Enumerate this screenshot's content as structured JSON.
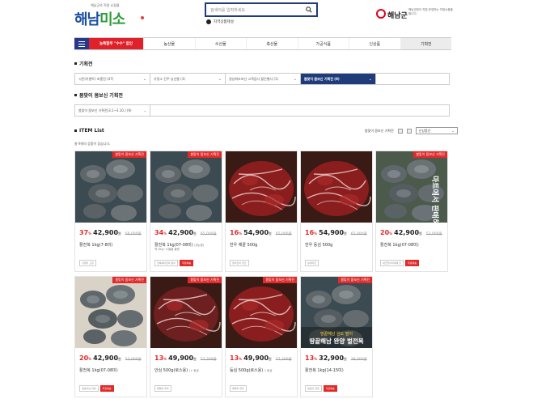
{
  "header": {
    "logo_small": "해남군의 직영 쇼핑몰",
    "logo_text_a": "해남",
    "logo_text_b": "미소",
    "search_placeholder": "검색어를 입력하세요",
    "region_link": "지역상품제설",
    "county_name": "해남군",
    "county_desc": "해남군청이 직접 운영하는 지방소중을 합니다."
  },
  "nav": {
    "promo": "농특할부 \"수수\" 없인",
    "items": [
      "농산물",
      "수산물",
      "축산물",
      "가공식품",
      "신상품",
      "기획전"
    ],
    "active_index": 5
  },
  "section1": {
    "title": "기획전",
    "filters": [
      "시즌(이벤트) 포홈전 (47)",
      "가정소 진주 농산물 (3)",
      "영상화조보선 고객감사 할인행사 (1)",
      "봄맞이 몸보신 기획전 (9)"
    ],
    "active_filter": 3
  },
  "section2": {
    "title": "봄맞이 몸보신 기획전",
    "filter": "봄맞이 몸보신 기획전(3.1~3.10.) (9)"
  },
  "list": {
    "title": "ITEM List",
    "count_text": "총 9개의 상품이 있습니다.",
    "sort_label": "봄맞이 몸보신 기획전",
    "sort_select": "신상품순"
  },
  "products": [
    {
      "badge": "봄맞이 몸보신 기획전",
      "discount": "37",
      "price": "42,900",
      "orig": "68,000원",
      "name": "활전복 1kg(7-8미)",
      "name2": "",
      "tags": [
        "사정이 고장"
      ],
      "ship": "",
      "img": "abalone1"
    },
    {
      "badge": "봄맞이 몸보신 기획전",
      "discount": "34",
      "price": "42,900",
      "orig": "65,000원",
      "name": "활전복 1kg(07-08미)",
      "name_opt": "(대)(중)",
      "name2": "적 5kg~스들을 돌렸",
      "tags": [
        "전복에이당의 영이"
      ],
      "ship": "무료배송",
      "img": "abalone2"
    },
    {
      "badge": "",
      "discount": "16",
      "price": "54,900",
      "orig": "65,000원",
      "name": "한우 채끝 500g",
      "name2": "",
      "tags": [
        "영이진이 천건"
      ],
      "ship": "",
      "img": "beef1"
    },
    {
      "badge": "",
      "discount": "16",
      "price": "54,900",
      "orig": "65,000원",
      "name": "한우 등심 500g",
      "name2": "",
      "tags": [
        "성세각진"
      ],
      "ship": "",
      "img": "beef2"
    },
    {
      "badge": "봄맞이 몸보신 기획전",
      "discount": "20",
      "price": "42,900",
      "orig": "53,000원",
      "name": "활전복 1kg(07-08미)",
      "name2": "",
      "tags": [
        "내군전이마이에 한"
      ],
      "ship": "무료배송",
      "img": "abalone3"
    },
    {
      "badge": "봄맞이 몸보신 기획전",
      "discount": "20",
      "price": "42,900",
      "orig": "53,000원",
      "name": "활전복 1kg(07-08미)",
      "name2": "",
      "tags": [
        "정남이님 한생"
      ],
      "ship": "무료배송",
      "img": "abalone4"
    },
    {
      "badge": "봄맞이 몸보신 기획전",
      "discount": "13",
      "price": "49,900",
      "orig": "57,300원",
      "name": "안심 500g(로스용)",
      "name_opt": "(+ 동급",
      "name2": "",
      "tags": [
        "영업의 한우"
      ],
      "ship": "",
      "img": "beef3"
    },
    {
      "badge": "봄맞이 몸보신 기획전",
      "discount": "13",
      "price": "49,900",
      "orig": "57,300원",
      "name": "등심 500g(로스용)",
      "name_opt": "1 동급",
      "name2": "",
      "tags": [
        "영업의 한우"
      ],
      "ship": "",
      "img": "beef4"
    },
    {
      "badge": "봄맞이 몸보신 기획전",
      "discount": "13",
      "price": "32,900",
      "orig": "38,000원",
      "name": "활전복 1kg(14-15미)",
      "name2": "",
      "tags": [
        "정남이 한전"
      ],
      "ship": "무료배송",
      "img": "abalone5"
    }
  ],
  "img_text": {
    "abalone3": "마트에서 판매하기",
    "abalone5_a": "땅끝해남 완도 떨어",
    "abalone5_b": "땅끝해남 완양 벌전복"
  },
  "colors": {
    "accent_red": "#e12a2a",
    "navy": "#1f3b7a"
  }
}
